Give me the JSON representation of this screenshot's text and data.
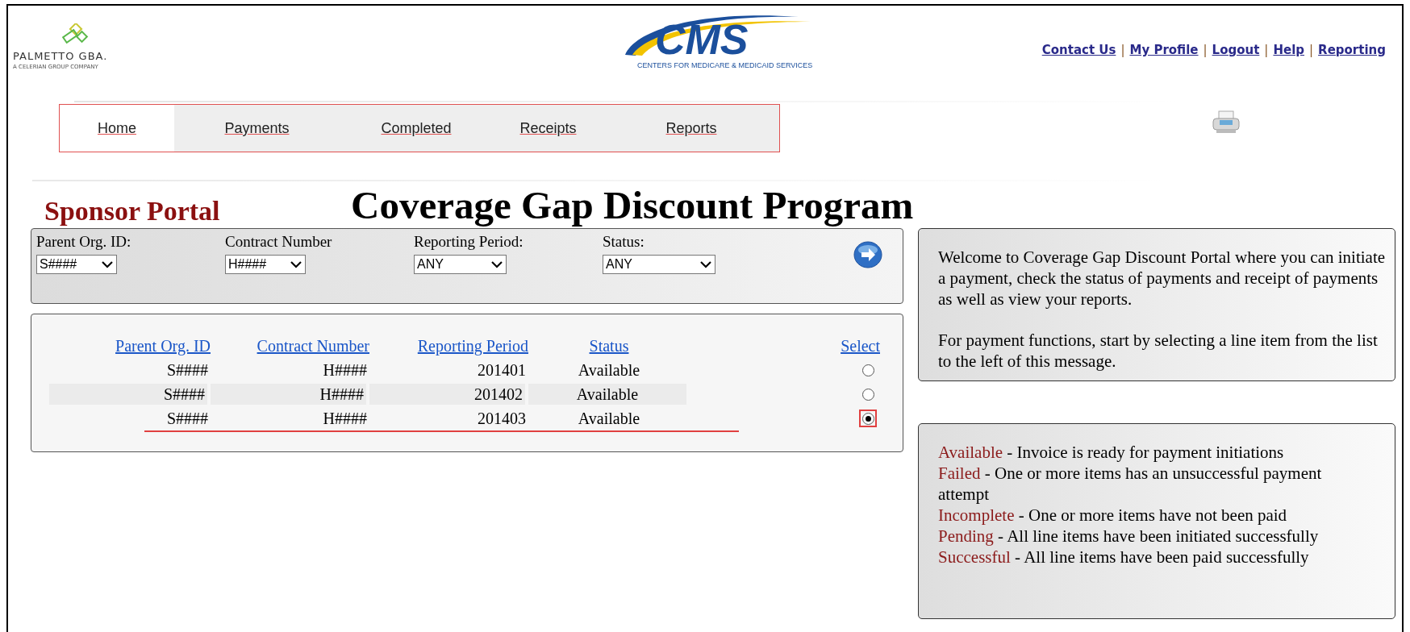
{
  "header": {
    "logo_left": {
      "name": "PALMETTO GBA.",
      "tagline": "A CELERIAN GROUP COMPANY"
    },
    "logo_center": {
      "name": "CMS",
      "tagline": "CENTERS FOR MEDICARE & MEDICAID SERVICES"
    },
    "links": [
      "Contact Us",
      "My Profile",
      "Logout",
      "Help",
      "Reporting"
    ],
    "link_separators": [
      "|",
      "|",
      "|",
      "|"
    ]
  },
  "nav": [
    {
      "label": "Home",
      "selected": true
    },
    {
      "label": "Payments",
      "selected": false
    },
    {
      "label": "Completed",
      "selected": false
    },
    {
      "label": "Receipts",
      "selected": false
    },
    {
      "label": "Reports",
      "selected": false
    }
  ],
  "portal_label": "Sponsor Portal",
  "page_title": "Coverage Gap Discount Program",
  "filters": [
    {
      "label": "Parent Org. ID:",
      "value": "S####"
    },
    {
      "label": "Contract Number",
      "value": "H####"
    },
    {
      "label": "Reporting Period:",
      "value": "ANY"
    },
    {
      "label": "Status:",
      "value": "ANY"
    }
  ],
  "table": {
    "columns": [
      "Parent Org. ID",
      "Contract Number",
      "Reporting Period",
      "Status",
      "Select"
    ],
    "rows": [
      {
        "cells": [
          "S####",
          "H####",
          "201401",
          "Available"
        ],
        "selected": false
      },
      {
        "cells": [
          "S####",
          "H####",
          "201402",
          "Available"
        ],
        "selected": false
      },
      {
        "cells": [
          "S####",
          "H####",
          "201403",
          "Available"
        ],
        "selected": true
      }
    ]
  },
  "welcome": [
    "Welcome to Coverage Gap Discount Portal where you can initiate a payment, check the status of payments and receipt of payments as well as view your reports.",
    "For payment functions, start by selecting a line item from the list to the left of this message."
  ],
  "legend": [
    {
      "term": "Available",
      "description": "- Invoice is ready for payment initiations"
    },
    {
      "term": "Failed",
      "description": "- One or more items has an unsuccessful payment attempt"
    },
    {
      "term": "Incomplete",
      "description": "- One or more items have not been paid"
    },
    {
      "term": "Pending",
      "description": "- All line items have been initiated successfully"
    },
    {
      "term": "Successful",
      "description": "- All line items have been paid successfully"
    }
  ]
}
